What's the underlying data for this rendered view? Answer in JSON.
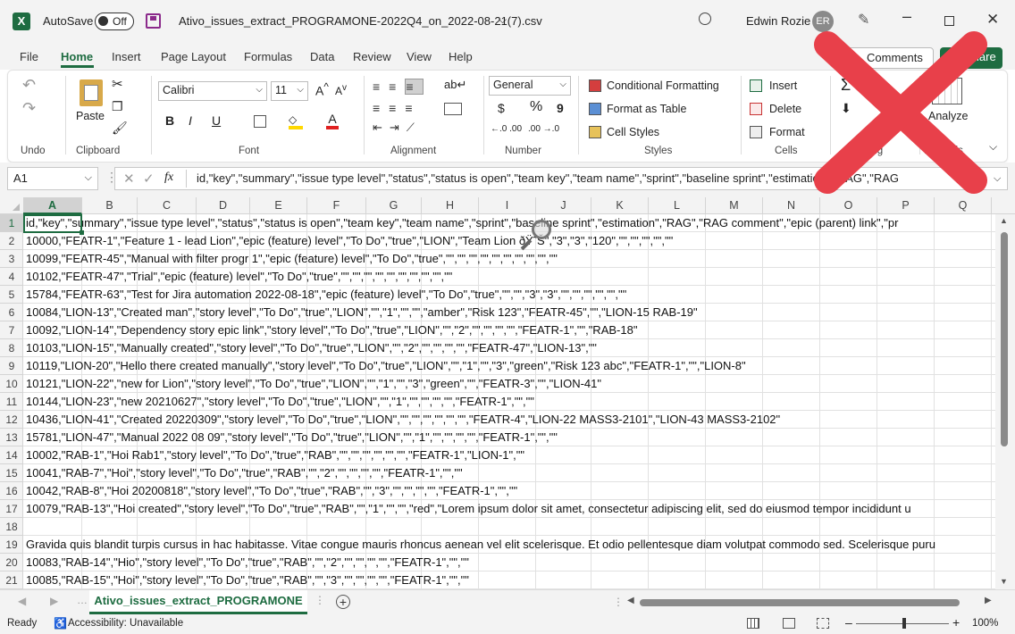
{
  "titlebar": {
    "autosave_label": "AutoSave",
    "autosave_state": "Off",
    "filename": "Ativo_issues_extract_PROGRAMONE-2022Q4_on_2022-08-21(7).csv",
    "user_name": "Edwin Rozie",
    "user_initials": "ER"
  },
  "tabs": [
    "File",
    "Home",
    "Insert",
    "Page Layout",
    "Formulas",
    "Data",
    "Review",
    "View",
    "Help"
  ],
  "comments_label": "Comments",
  "share_label": "Share",
  "ribbon": {
    "undo_label": "Undo",
    "clipboard": {
      "paste": "Paste",
      "label": "Clipboard"
    },
    "font": {
      "name": "Calibri",
      "size": "11",
      "label": "Font",
      "bold": "B",
      "italic": "I",
      "underline": "U"
    },
    "alignment": {
      "label": "Alignment"
    },
    "number": {
      "format": "General",
      "label": "Number",
      "dollar": "$",
      "percent": "%",
      "comma": "9",
      "inc": "←.0 .00",
      "dec": ".00 →.0"
    },
    "styles": {
      "conditional": "Conditional Formatting",
      "format_table": "Format as Table",
      "cell_styles": "Cell Styles",
      "label": "Styles"
    },
    "cells": {
      "insert": "Insert",
      "delete": "Delete",
      "format": "Format",
      "label": "Cells"
    },
    "editing": {
      "label": "Editing"
    },
    "analysis": {
      "analyze": "Analyze",
      "label": "Analysis"
    }
  },
  "formula": {
    "name_box": "A1",
    "fx": "fx",
    "content": "id,\"key\",\"summary\",\"issue type level\",\"status\",\"status is open\",\"team key\",\"team name\",\"sprint\",\"baseline sprint\",\"estimation\",\"RAG\",\"RAG"
  },
  "columns": [
    "A",
    "B",
    "C",
    "D",
    "E",
    "F",
    "G",
    "H",
    "I",
    "J",
    "K",
    "L",
    "M",
    "N",
    "O",
    "P",
    "Q"
  ],
  "rows": [
    {
      "n": "1",
      "t": "id,\"key\",\"summary\",\"issue type level\",\"status\",\"status is open\",\"team key\",\"team name\",\"sprint\",\"baseline sprint\",\"estimation\",\"RAG\",\"RAG comment\",\"epic (parent) link\",\"pr"
    },
    {
      "n": "2",
      "t": "10000,\"FEATR-1\",\"Feature 1 - lead Lion\",\"epic (feature) level\",\"To Do\",\"true\",\"LION\",\"Team Lion ðŸ˜Š\",\"3\",\"3\",\"120\",\"\",\"\",\"\",\"\",\"\""
    },
    {
      "n": "3",
      "t": "10099,\"FEATR-45\",\"Manual with filter progr 1\",\"epic (feature) level\",\"To Do\",\"true\",\"\",\"\",\"\",\"\",\"\",\"\",\"\",\"\",\"\",\"\""
    },
    {
      "n": "4",
      "t": "10102,\"FEATR-47\",\"Trial\",\"epic (feature) level\",\"To Do\",\"true\",\"\",\"\",\"\",\"\",\"\",\"\",\"\",\"\",\"\",\"\""
    },
    {
      "n": "5",
      "t": "15784,\"FEATR-63\",\"Test for Jira automation 2022-08-18\",\"epic (feature) level\",\"To Do\",\"true\",\"\",\"\",\"3\",\"3\",\"\",\"\",\"\",\"\",\"\",\"\""
    },
    {
      "n": "6",
      "t": "10084,\"LION-13\",\"Created man\",\"story level\",\"To Do\",\"true\",\"LION\",\"\",\"1\",\"\",\"\",\"amber\",\"Risk 123\",\"FEATR-45\",\"\",\"LION-15 RAB-19\""
    },
    {
      "n": "7",
      "t": "10092,\"LION-14\",\"Dependency story epic link\",\"story level\",\"To Do\",\"true\",\"LION\",\"\",\"2\",\"\",\"\",\"\",\"\",\"FEATR-1\",\"\",\"RAB-18\""
    },
    {
      "n": "8",
      "t": "10103,\"LION-15\",\"Manually created\",\"story level\",\"To Do\",\"true\",\"LION\",\"\",\"2\",\"\",\"\",\"\",\"\",\"FEATR-47\",\"LION-13\",\"\""
    },
    {
      "n": "9",
      "t": "10119,\"LION-20\",\"Hello there created manually\",\"story level\",\"To Do\",\"true\",\"LION\",\"\",\"1\",\"\",\"3\",\"green\",\"Risk 123 abc\",\"FEATR-1\",\"\",\"LION-8\""
    },
    {
      "n": "10",
      "t": "10121,\"LION-22\",\"new for Lion\",\"story level\",\"To Do\",\"true\",\"LION\",\"\",\"1\",\"\",\"3\",\"green\",\"\",\"FEATR-3\",\"\",\"LION-41\""
    },
    {
      "n": "11",
      "t": "10144,\"LION-23\",\"new 20210627\",\"story level\",\"To Do\",\"true\",\"LION\",\"\",\"1\",\"\",\"\",\"\",\"\",\"FEATR-1\",\"\",\"\""
    },
    {
      "n": "12",
      "t": "10436,\"LION-41\",\"Created 20220309\",\"story level\",\"To Do\",\"true\",\"LION\",\"\",\"\",\"\",\"\",\"\",\"\",\"FEATR-4\",\"LION-22 MASS3-2101\",\"LION-43 MASS3-2102\""
    },
    {
      "n": "13",
      "t": "15781,\"LION-47\",\"Manual 2022 08 09\",\"story level\",\"To Do\",\"true\",\"LION\",\"\",\"1\",\"\",\"\",\"\",\"\",\"FEATR-1\",\"\",\"\""
    },
    {
      "n": "14",
      "t": "10002,\"RAB-1\",\"Hoi Rab1\",\"story level\",\"To Do\",\"true\",\"RAB\",\"\",\"\",\"\",\"\",\"\",\"\",\"FEATR-1\",\"LION-1\",\"\""
    },
    {
      "n": "15",
      "t": "10041,\"RAB-7\",\"Hoi\",\"story level\",\"To Do\",\"true\",\"RAB\",\"\",\"2\",\"\",\"\",\"\",\"\",\"FEATR-1\",\"\",\"\""
    },
    {
      "n": "16",
      "t": "10042,\"RAB-8\",\"Hoi 20200818\",\"story level\",\"To Do\",\"true\",\"RAB\",\"\",\"3\",\"\",\"\",\"\",\"\",\"FEATR-1\",\"\",\"\""
    },
    {
      "n": "17",
      "t": "10079,\"RAB-13\",\"Hoi created\",\"story level\",\"To Do\",\"true\",\"RAB\",\"\",\"1\",\"\",\"\",\"red\",\"Lorem ipsum dolor sit amet, consectetur adipiscing elit, sed do eiusmod tempor incididunt u"
    },
    {
      "n": "18",
      "t": ""
    },
    {
      "n": "19",
      "t": "Gravida quis blandit turpis cursus in hac habitasse. Vitae congue mauris rhoncus aenean vel elit scelerisque. Et odio pellentesque diam volutpat commodo sed. Scelerisque puru"
    },
    {
      "n": "20",
      "t": "10083,\"RAB-14\",\"Hio\",\"story level\",\"To Do\",\"true\",\"RAB\",\"\",\"2\",\"\",\"\",\"\",\"\",\"FEATR-1\",\"\",\"\""
    },
    {
      "n": "21",
      "t": "10085,\"RAB-15\",\"Hoi\",\"story level\",\"To Do\",\"true\",\"RAB\",\"\",\"3\",\"\",\"\",\"\",\"\",\"FEATR-1\",\"\",\"\""
    }
  ],
  "sheet_tab": "Ativo_issues_extract_PROGRAMONE",
  "status": {
    "ready": "Ready",
    "accessibility": "Accessibility: Unavailable",
    "zoom": "100%"
  },
  "colors": {
    "excel_green": "#1e6c41",
    "red_x": "#e8404a"
  }
}
